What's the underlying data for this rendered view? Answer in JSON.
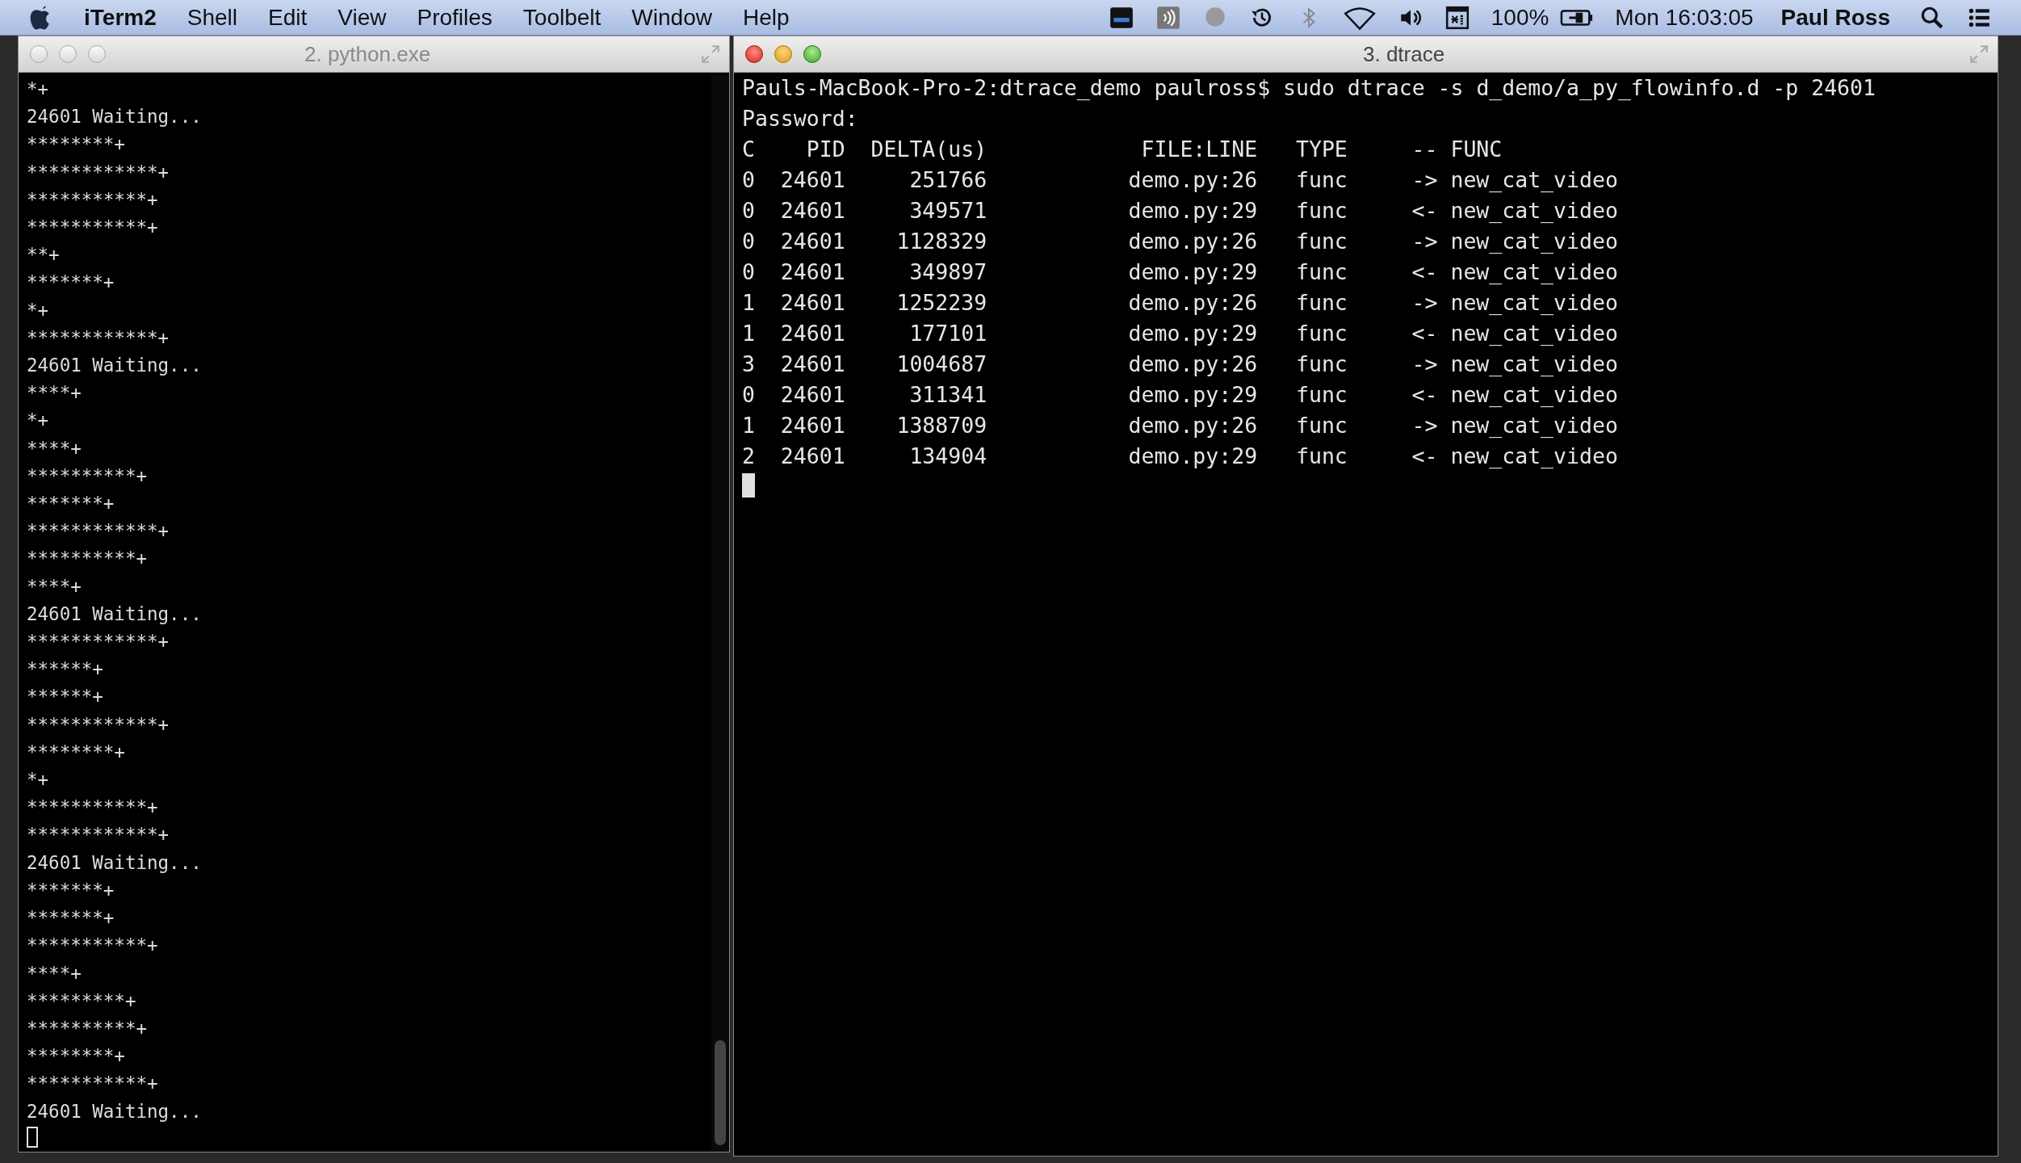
{
  "menu_bar": {
    "app_name": "iTerm2",
    "menus": [
      "Shell",
      "Edit",
      "View",
      "Profiles",
      "Toolbelt",
      "Window",
      "Help"
    ],
    "battery_text": "100%",
    "clock": "Mon 16:03:05",
    "user": "Paul Ross"
  },
  "windows": [
    {
      "title": "2. python.exe",
      "active": false,
      "lines": [
        "*+",
        "24601 Waiting...",
        "********+",
        "************+",
        "***********+",
        "***********+",
        "**+",
        "*******+",
        "*+",
        "************+",
        "24601 Waiting...",
        "****+",
        "*+",
        "****+",
        "**********+",
        "*******+",
        "************+",
        "**********+",
        "****+",
        "24601 Waiting...",
        "************+",
        "******+",
        "******+",
        "************+",
        "********+",
        "*+",
        "***********+",
        "************+",
        "24601 Waiting...",
        "*******+",
        "*******+",
        "***********+",
        "****+",
        "*********+",
        "**********+",
        "********+",
        "***********+",
        "24601 Waiting..."
      ]
    },
    {
      "title": "3. dtrace",
      "active": true,
      "lines": [
        "Pauls-MacBook-Pro-2:dtrace_demo paulross$ sudo dtrace -s d_demo/a_py_flowinfo.d -p 24601",
        "Password:"
      ],
      "table": {
        "columns": [
          "C",
          "PID",
          "DELTA(us)",
          "FILE:LINE",
          "TYPE",
          "-- FUNC"
        ],
        "rows": [
          [
            "0",
            "24601",
            "251766",
            "demo.py:26",
            "func",
            "-> new_cat_video"
          ],
          [
            "0",
            "24601",
            "349571",
            "demo.py:29",
            "func",
            "<- new_cat_video"
          ],
          [
            "0",
            "24601",
            "1128329",
            "demo.py:26",
            "func",
            "-> new_cat_video"
          ],
          [
            "0",
            "24601",
            "349897",
            "demo.py:29",
            "func",
            "<- new_cat_video"
          ],
          [
            "1",
            "24601",
            "1252239",
            "demo.py:26",
            "func",
            "-> new_cat_video"
          ],
          [
            "1",
            "24601",
            "177101",
            "demo.py:29",
            "func",
            "<- new_cat_video"
          ],
          [
            "3",
            "24601",
            "1004687",
            "demo.py:26",
            "func",
            "-> new_cat_video"
          ],
          [
            "0",
            "24601",
            "311341",
            "demo.py:29",
            "func",
            "<- new_cat_video"
          ],
          [
            "1",
            "24601",
            "1388709",
            "demo.py:26",
            "func",
            "-> new_cat_video"
          ],
          [
            "2",
            "24601",
            "134904",
            "demo.py:29",
            "func",
            "<- new_cat_video"
          ]
        ]
      }
    }
  ]
}
